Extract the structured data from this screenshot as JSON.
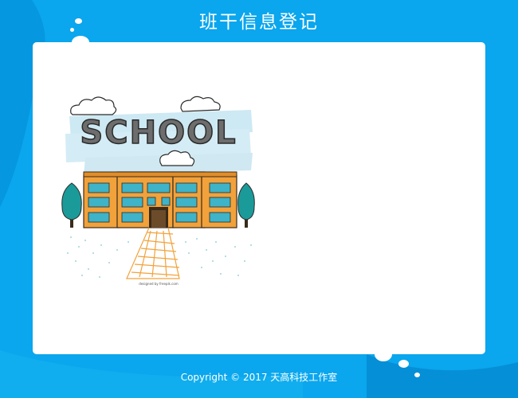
{
  "header": {
    "title": "班干信息登记"
  },
  "illustration": {
    "sign_text": "SCHOOL",
    "credit_text": "designed by freepik.com"
  },
  "footer": {
    "copyright": "Copyright © 2017 天高科技工作室"
  },
  "colors": {
    "background": "#0aa6ee",
    "wave": "#36c3f7",
    "card": "#ffffff",
    "building": "#f2a23b",
    "trees": "#1b9a9a"
  },
  "icons": [
    "school-building-icon",
    "tree-icon",
    "cloud-icon"
  ]
}
